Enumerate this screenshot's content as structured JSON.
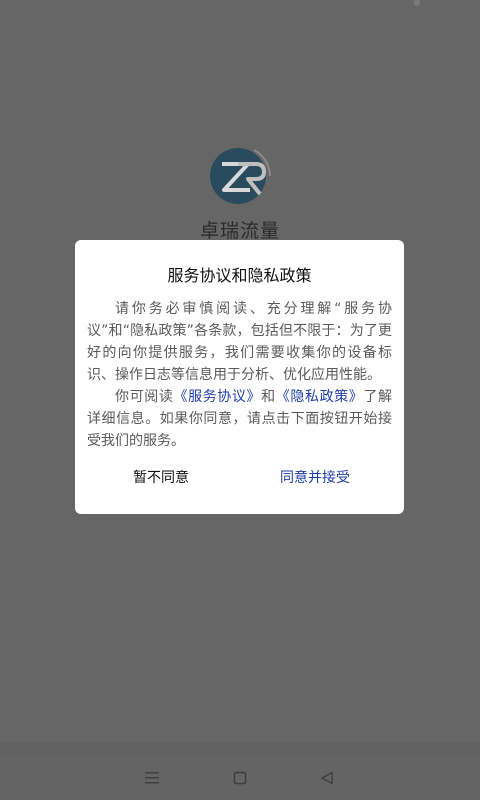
{
  "app": {
    "name": "卓瑞流量",
    "logo_icon": "zr-logo-icon"
  },
  "dialog": {
    "title": "服务协议和隐私政策",
    "paragraph1": "请你务必审慎阅读、充分理解“服务协议”和“隐私政策”各条款，包括但不限于：为了更好的向你提供服务，我们需要收集你的设备标识、操作日志等信息用于分析、优化应用性能。",
    "paragraph2_prefix": "你可阅读",
    "terms_link": "《服务协议》",
    "paragraph2_and": "和",
    "privacy_link": "《隐私政策》",
    "paragraph2_suffix": "了解详细信息。如果你同意，请点击下面按钮开始接受我们的服务。",
    "decline_label": "暂不同意",
    "accept_label": "同意并接受"
  },
  "nav": {
    "menu_icon": "menu-icon",
    "home_icon": "home-icon",
    "back_icon": "back-icon"
  },
  "colors": {
    "overlay": "#666666",
    "link": "#1f3fa8",
    "logo_blue": "#2a6f9e"
  }
}
